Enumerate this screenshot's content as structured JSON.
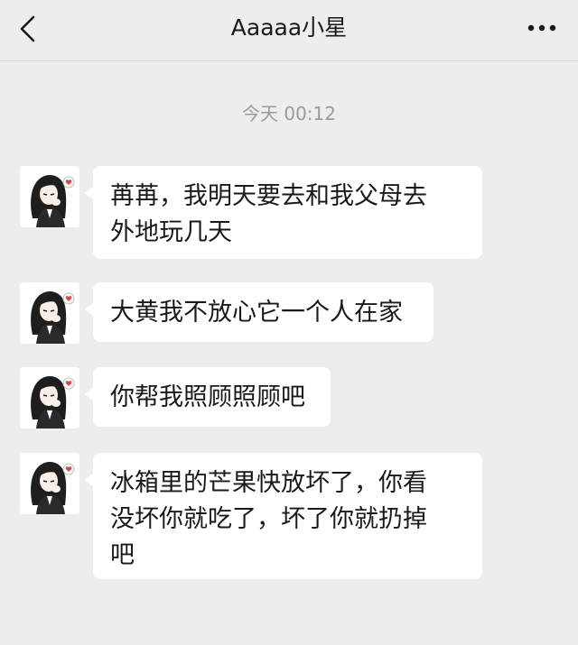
{
  "header": {
    "title": "Aaaaa小星",
    "back_icon": "chevron-left-icon",
    "more_icon": "ellipsis-icon"
  },
  "timestamp": "今天 00:12",
  "messages": [
    {
      "lines": [
        "苒苒，我明天要去和我父母去",
        "外地玩几天"
      ]
    },
    {
      "lines": [
        "大黄我不放心它一个人在家"
      ]
    },
    {
      "lines": [
        "你帮我照顾照顾吧"
      ]
    },
    {
      "lines": [
        "冰箱里的芒果快放坏了，你看",
        "没坏你就吃了，坏了你就扔掉",
        "吧"
      ]
    }
  ],
  "colors": {
    "background": "#ededed",
    "bubble": "#ffffff",
    "text": "#191919",
    "timestamp": "#9a9a9a"
  }
}
